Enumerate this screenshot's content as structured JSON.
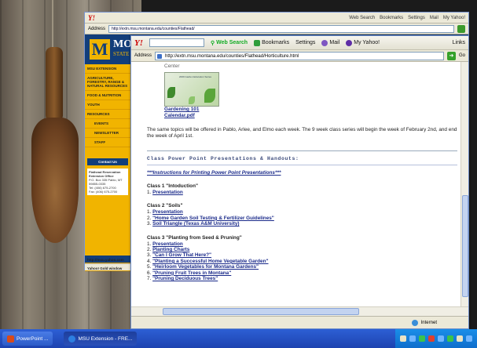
{
  "background": {
    "panel": {
      "name": "Flathead Reservation Extension Office"
    }
  },
  "back_window": {
    "address": "http://extn.msu.montana.edu/counties/Flathead/",
    "brand": {
      "initial": "M",
      "name": "MO",
      "sub": "STATE"
    },
    "sidebar": [
      "MSU EXTENSION",
      "AGRICULTURE, FORESTRY, RANGE & NATURAL RESOURCES",
      "FOOD & NUTRITION",
      "YOUTH",
      "RESOURCES",
      "EVENTS",
      "NEWSLETTER",
      "STAFF"
    ],
    "contact": {
      "heading": "Contact Us",
      "office": "Flathead Reservation Extension Office",
      "box": "P.O. Box 335 Pablo, MT 59855-0335",
      "tel": "Tel: (406) 675-2700",
      "fax": "Fax: (406) 675-2700"
    },
    "status_url": "http://msu.yahoo.com",
    "status_text": "Yahoo! Gold window"
  },
  "front_window": {
    "toolbar": {
      "yahoo_label": "Y!",
      "web_search_label": "Web Search",
      "bookmarks_label": "Bookmarks",
      "settings_label": "Settings",
      "mail_label": "Mail",
      "myyahoo_label": "My Yahoo!",
      "links_label": "Links"
    },
    "address_label": "Address",
    "address_value": "http://extn.msu.montana.edu/counties/Flathead/Horticulture.html",
    "go_label": "Go",
    "page": {
      "center_label": "Center",
      "poster_text": "2009 Garden Education Series",
      "pdf_link_line1": "Gardening 101",
      "pdf_link_line2": "Calendar.pdf",
      "intro_paragraph": "The same topics will be offered in Pablo, Arlee, and Elmo each week. The 9 week class series will begin the week of February 2nd, and end the week of April 1st.",
      "section_title": "Class Power Point Presentations & Handouts:",
      "instructions_link": "***Instructions for Printing Power Point Presentations***",
      "classes": [
        {
          "title": "Class 1 \"Intoduction\"",
          "items": [
            {
              "num": "1. ",
              "label": "Presentation"
            }
          ]
        },
        {
          "title": "Class 2 \"Soils\"",
          "items": [
            {
              "num": "1. ",
              "label": "Presentation"
            },
            {
              "num": "2. ",
              "label": "\"Home Garden Soil Testing & Fertilizer Guidelines\""
            },
            {
              "num": "3. ",
              "label": "Soil Triangle (Texas A&M University)"
            }
          ]
        },
        {
          "title": "Class 3 \"Planting from Seed & Pruning\"",
          "items": [
            {
              "num": "1. ",
              "label": "Presentation"
            },
            {
              "num": "2. ",
              "label": "Planting Charts"
            },
            {
              "num": "3. ",
              "label": "\"Can I Grow That Here?\""
            },
            {
              "num": "4. ",
              "label": "\"Planting a Successful Home Vegetable Garden\""
            },
            {
              "num": "5. ",
              "label": "\"Heirloom Vegetables for Montana Gardens\""
            },
            {
              "num": "6. ",
              "label": "\"Pruning Fruit Trees in Montana\""
            },
            {
              "num": "7. ",
              "label": "\"Pruning Deciduous Trees\""
            }
          ]
        }
      ]
    },
    "status": {
      "zone": "Internet"
    }
  },
  "taskbar": {
    "items": [
      {
        "label": "PowerPoint ..."
      },
      {
        "label": "MSU Extension - FRE..."
      }
    ]
  }
}
